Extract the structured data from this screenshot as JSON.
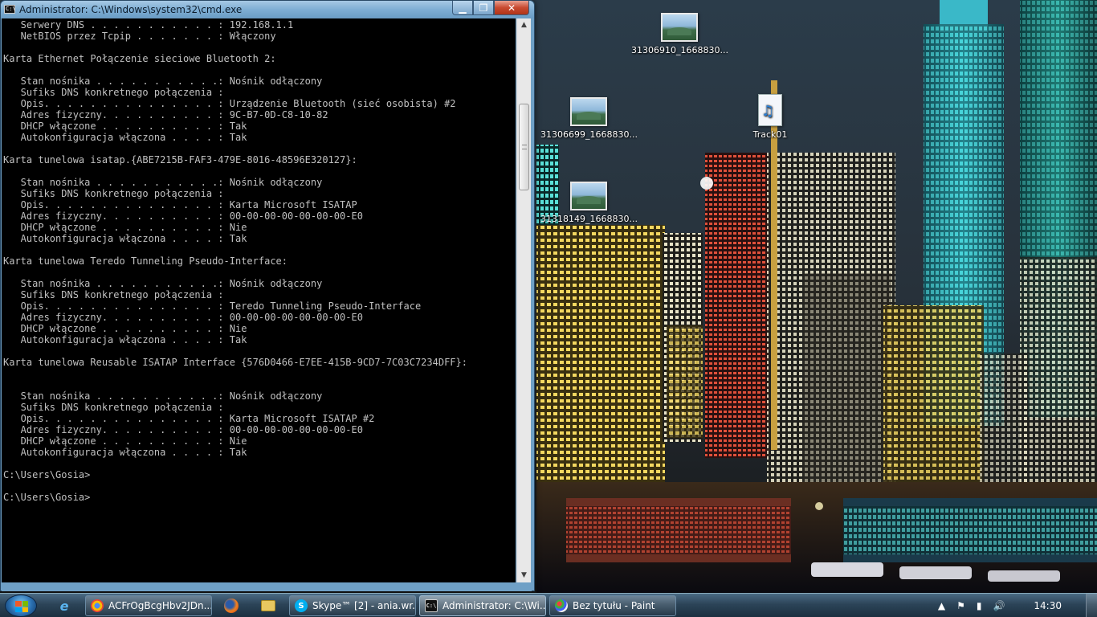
{
  "window": {
    "title": "Administrator: C:\\Windows\\system32\\cmd.exe",
    "icon": "cmd-icon",
    "console_lines": [
      "   Serwery DNS . . . . . . . . . . . : 192.168.1.1",
      "   NetBIOS przez Tcpip . . . . . . . : Włączony",
      "",
      "Karta Ethernet Połączenie sieciowe Bluetooth 2:",
      "",
      "   Stan nośnika . . . . . . . . . . .: Nośnik odłączony",
      "   Sufiks DNS konkretnego połączenia :",
      "   Opis. . . . . . . . . . . . . . . : Urządzenie Bluetooth (sieć osobista) #2",
      "   Adres fizyczny. . . . . . . . . . : 9C-B7-0D-C8-10-82",
      "   DHCP włączone . . . . . . . . . . : Tak",
      "   Autokonfiguracja włączona . . . . : Tak",
      "",
      "Karta tunelowa isatap.{ABE7215B-FAF3-479E-8016-48596E320127}:",
      "",
      "   Stan nośnika . . . . . . . . . . .: Nośnik odłączony",
      "   Sufiks DNS konkretnego połączenia :",
      "   Opis. . . . . . . . . . . . . . . : Karta Microsoft ISATAP",
      "   Adres fizyczny. . . . . . . . . . : 00-00-00-00-00-00-00-E0",
      "   DHCP włączone . . . . . . . . . . : Nie",
      "   Autokonfiguracja włączona . . . . : Tak",
      "",
      "Karta tunelowa Teredo Tunneling Pseudo-Interface:",
      "",
      "   Stan nośnika . . . . . . . . . . .: Nośnik odłączony",
      "   Sufiks DNS konkretnego połączenia :",
      "   Opis. . . . . . . . . . . . . . . : Teredo Tunneling Pseudo-Interface",
      "   Adres fizyczny. . . . . . . . . . : 00-00-00-00-00-00-00-E0",
      "   DHCP włączone . . . . . . . . . . : Nie",
      "   Autokonfiguracja włączona . . . . : Tak",
      "",
      "Karta tunelowa Reusable ISATAP Interface {576D0466-E7EE-415B-9CD7-7C03C7234DFF}:",
      "",
      "",
      "   Stan nośnika . . . . . . . . . . .: Nośnik odłączony",
      "   Sufiks DNS konkretnego połączenia :",
      "   Opis. . . . . . . . . . . . . . . : Karta Microsoft ISATAP #2",
      "   Adres fizyczny. . . . . . . . . . : 00-00-00-00-00-00-00-E0",
      "   DHCP włączone . . . . . . . . . . : Nie",
      "   Autokonfiguracja włączona . . . . : Tak",
      "",
      "C:\\Users\\Gosia>",
      "",
      "C:\\Users\\Gosia>"
    ],
    "buttons": {
      "minimize": "▁",
      "maximize": "❐",
      "close": "✕"
    }
  },
  "desktop_icons": [
    {
      "label": "31306910_1668830...",
      "type": "image-file-icon"
    },
    {
      "label": "31306699_1668830...",
      "type": "image-file-icon"
    },
    {
      "label": "Track01",
      "type": "audio-file-icon"
    },
    {
      "label": "31318149_1668830...",
      "type": "image-file-icon"
    }
  ],
  "taskbar": {
    "items": [
      {
        "label": "ACFrOgBcgHbv2JDn...",
        "icon": "chrome-icon"
      },
      {
        "label": "Skype™ [2] - ania.wr...",
        "icon": "skype-icon"
      },
      {
        "label": "Administrator: C:\\Wi...",
        "icon": "cmd-icon"
      },
      {
        "label": "Bez tytułu - Paint",
        "icon": "paint-icon"
      }
    ],
    "clock": "14:30"
  },
  "colors": {
    "console_bg": "#000000",
    "console_fg": "#c0c0c0",
    "titlebar": "#7eaed4",
    "taskbar": "#2c4458",
    "close_button": "#c84a30"
  }
}
